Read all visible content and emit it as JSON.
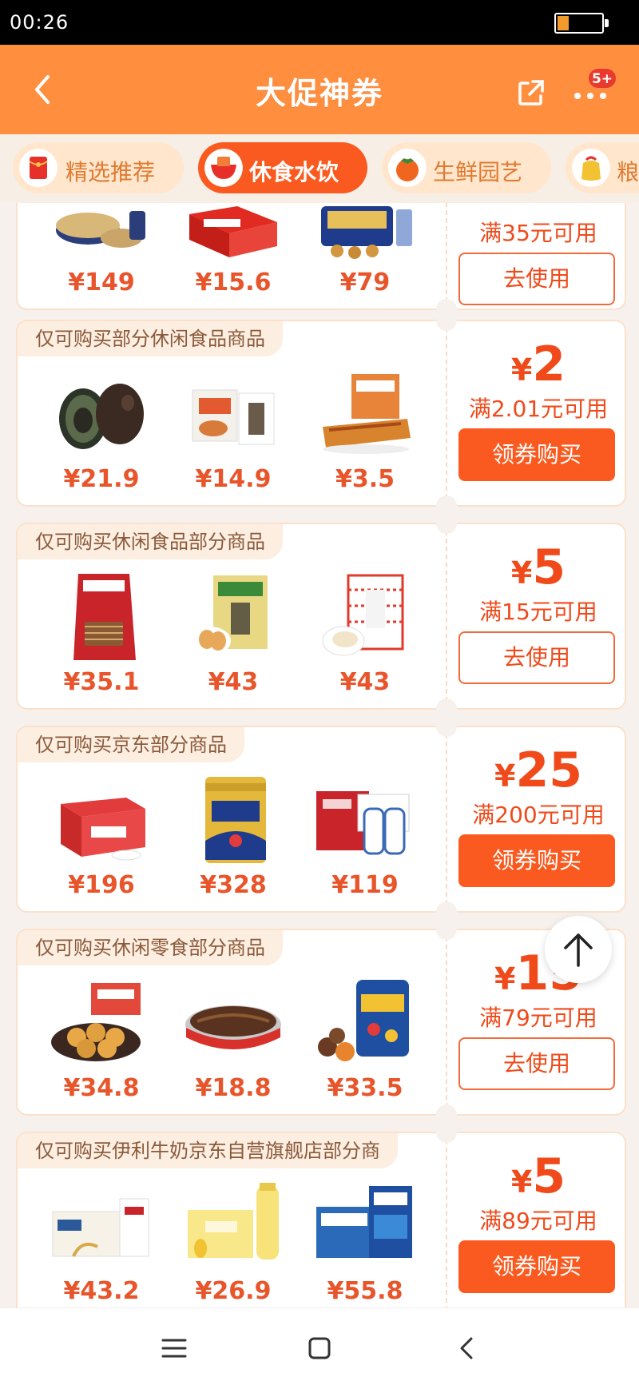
{
  "status_bar": {
    "time": "00:26"
  },
  "header": {
    "title": "大促神券",
    "badge": "5+"
  },
  "colors": {
    "brand_orange": "#ff8f3f",
    "accent_red": "#fa5a1f",
    "price_red": "#e8552b"
  },
  "tabs": [
    {
      "label": "精选推荐",
      "icon": "red-envelope-icon",
      "active": false
    },
    {
      "label": "休食水饮",
      "icon": "snack-bowl-icon",
      "active": true
    },
    {
      "label": "生鲜园艺",
      "icon": "persimmon-icon",
      "active": false
    },
    {
      "label": "粮",
      "icon": "grain-bag-icon",
      "active": false
    }
  ],
  "coupons": [
    {
      "scope": "",
      "products": [
        {
          "price": "¥149"
        },
        {
          "price": "¥15.6"
        },
        {
          "price": "¥79"
        }
      ],
      "amount": "",
      "threshold": "满35元可用",
      "button": "去使用"
    },
    {
      "scope": "仅可购买部分休闲食品商品",
      "products": [
        {
          "price": "¥21.9"
        },
        {
          "price": "¥14.9"
        },
        {
          "price": "¥3.5"
        }
      ],
      "amount": "2",
      "threshold": "满2.01元可用",
      "button": "领券购买"
    },
    {
      "scope": "仅可购买休闲食品部分商品",
      "products": [
        {
          "price": "¥35.1"
        },
        {
          "price": "¥43"
        },
        {
          "price": "¥43"
        }
      ],
      "amount": "5",
      "threshold": "满15元可用",
      "button": "去使用"
    },
    {
      "scope": "仅可购买京东部分商品",
      "products": [
        {
          "price": "¥196"
        },
        {
          "price": "¥328"
        },
        {
          "price": "¥119"
        }
      ],
      "amount": "25",
      "threshold": "满200元可用",
      "button": "领券购买"
    },
    {
      "scope": "仅可购买休闲零食部分商品",
      "products": [
        {
          "price": "¥34.8"
        },
        {
          "price": "¥18.8"
        },
        {
          "price": "¥33.5"
        }
      ],
      "amount": "15",
      "threshold": "满79元可用",
      "button": "去使用"
    },
    {
      "scope": "仅可购买伊利牛奶京东自营旗舰店部分商",
      "products": [
        {
          "price": "¥43.2"
        },
        {
          "price": "¥26.9"
        },
        {
          "price": "¥55.8"
        }
      ],
      "amount": "5",
      "threshold": "满89元可用",
      "button": "领券购买"
    }
  ],
  "currency_symbol": "¥",
  "nav": {
    "icons": [
      "menu-icon",
      "home-square-icon",
      "back-chevron-icon"
    ]
  }
}
